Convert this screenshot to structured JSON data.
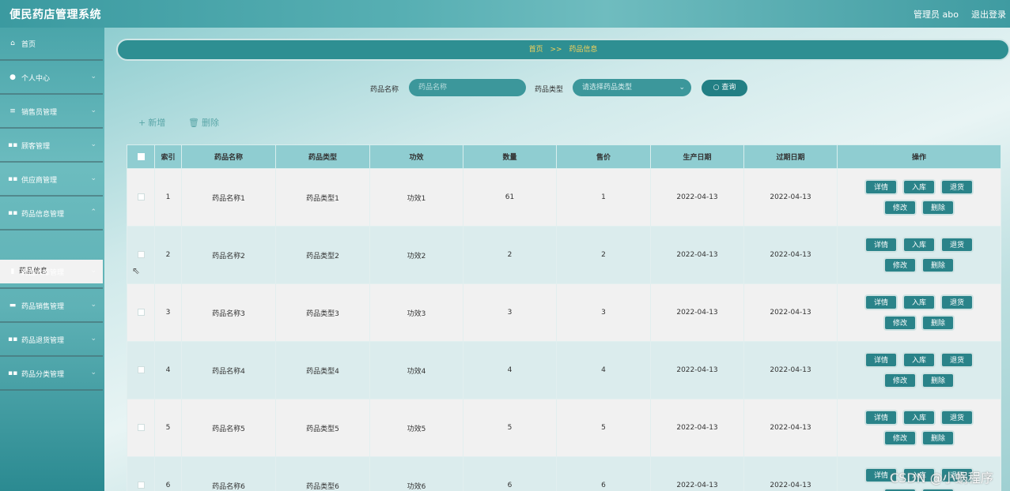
{
  "header": {
    "app_title": "便民药店管理系统",
    "user_label": "管理员 abo",
    "logout_label": "退出登录"
  },
  "sidebar": {
    "items": [
      {
        "label": "首页",
        "icon": "home-icon"
      },
      {
        "label": "个人中心",
        "icon": "user-icon"
      },
      {
        "label": "销售员管理",
        "icon": "list-icon"
      },
      {
        "label": "顾客管理",
        "icon": "grid-icon"
      },
      {
        "label": "供应商管理",
        "icon": "grid-icon"
      },
      {
        "label": "药品信息管理",
        "icon": "grid-icon"
      },
      {
        "label": "药品入库管理",
        "icon": "clipboard-icon"
      },
      {
        "label": "药品销售管理",
        "icon": "bag-icon"
      },
      {
        "label": "药品退货管理",
        "icon": "grid-icon"
      },
      {
        "label": "药品分类管理",
        "icon": "grid-icon"
      }
    ],
    "active_sub": "药品信息"
  },
  "breadcrumb": {
    "home": "首页",
    "sep": ">>",
    "current": "药品信息"
  },
  "search": {
    "name_label": "药品名称",
    "name_placeholder": "药品名称",
    "type_label": "药品类型",
    "type_placeholder": "请选择药品类型",
    "query_label": "查询"
  },
  "toolbar": {
    "add_label": "新增",
    "delete_label": "删除"
  },
  "table": {
    "headers": [
      "索引",
      "药品名称",
      "药品类型",
      "功效",
      "数量",
      "售价",
      "生产日期",
      "过期日期",
      "操作"
    ],
    "rows": [
      {
        "index": "1",
        "name": "药品名称1",
        "type": "药品类型1",
        "effect": "功效1",
        "qty": "61",
        "price": "1",
        "mfg": "2022-04-13",
        "exp": "2022-04-13"
      },
      {
        "index": "2",
        "name": "药品名称2",
        "type": "药品类型2",
        "effect": "功效2",
        "qty": "2",
        "price": "2",
        "mfg": "2022-04-13",
        "exp": "2022-04-13"
      },
      {
        "index": "3",
        "name": "药品名称3",
        "type": "药品类型3",
        "effect": "功效3",
        "qty": "3",
        "price": "3",
        "mfg": "2022-04-13",
        "exp": "2022-04-13"
      },
      {
        "index": "4",
        "name": "药品名称4",
        "type": "药品类型4",
        "effect": "功效4",
        "qty": "4",
        "price": "4",
        "mfg": "2022-04-13",
        "exp": "2022-04-13"
      },
      {
        "index": "5",
        "name": "药品名称5",
        "type": "药品类型5",
        "effect": "功效5",
        "qty": "5",
        "price": "5",
        "mfg": "2022-04-13",
        "exp": "2022-04-13"
      },
      {
        "index": "6",
        "name": "药品名称6",
        "type": "药品类型6",
        "effect": "功效6",
        "qty": "6",
        "price": "6",
        "mfg": "2022-04-13",
        "exp": "2022-04-13"
      }
    ],
    "actions": {
      "detail": "详情",
      "stock_in": "入库",
      "return": "退货",
      "edit": "修改",
      "delete": "删除"
    }
  },
  "watermark": "CSDN @小蜗程序",
  "colors": {
    "primary": "#2a8389",
    "header_row": "#8fcdd1",
    "crumb_text": "#f5d15a"
  }
}
